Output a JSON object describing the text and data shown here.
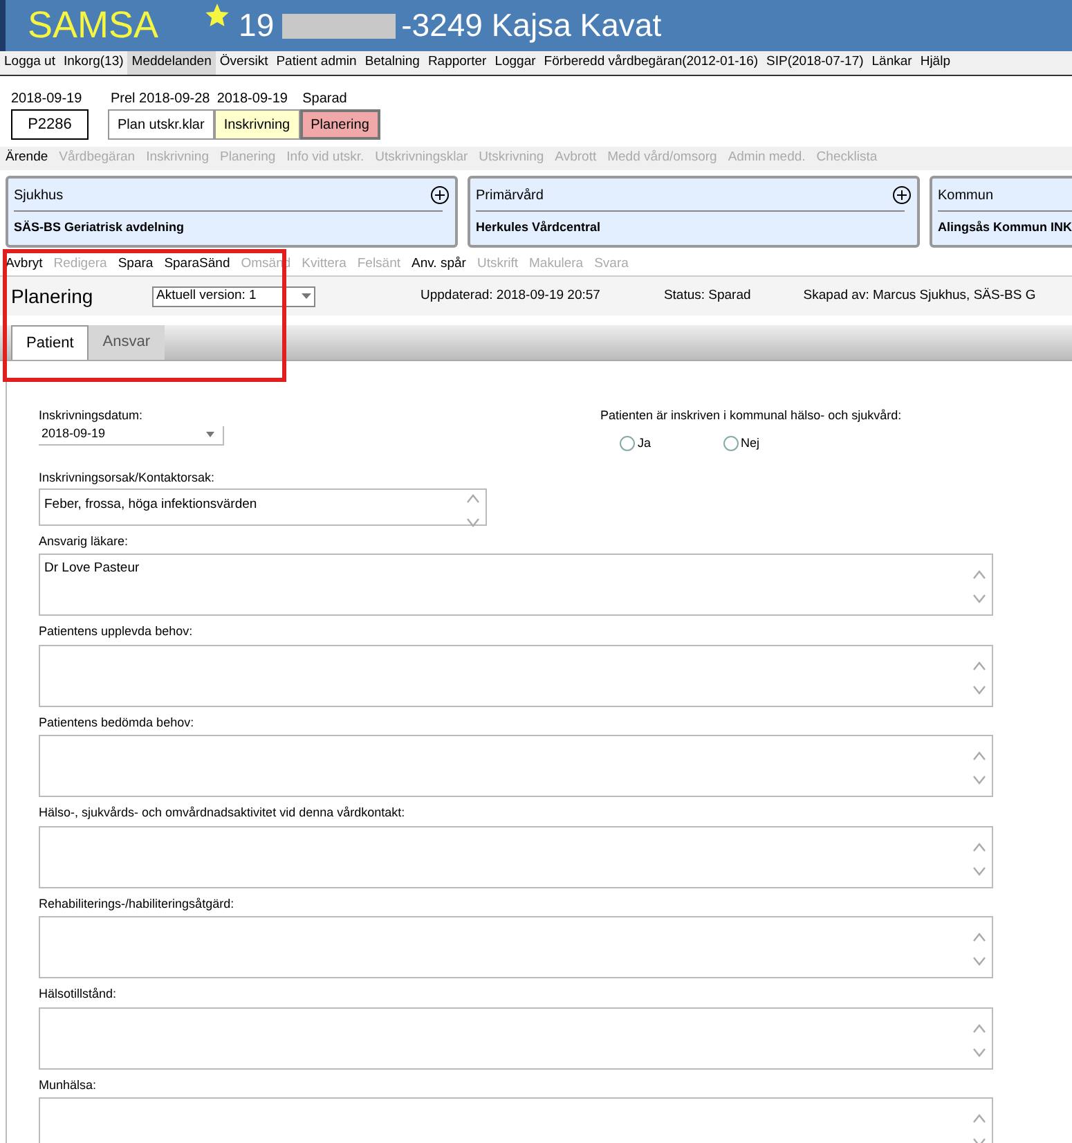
{
  "header": {
    "logo": "SAMSA",
    "patient_prefix": "19",
    "patient_suffix": "-3249 Kajsa Kavat"
  },
  "menu": [
    {
      "label": "Logga ut",
      "selected": false
    },
    {
      "label": "Inkorg(13)",
      "selected": false
    },
    {
      "label": "Meddelanden",
      "selected": true
    },
    {
      "label": "Översikt",
      "selected": false
    },
    {
      "label": "Patient admin",
      "selected": false
    },
    {
      "label": "Betalning",
      "selected": false
    },
    {
      "label": "Rapporter",
      "selected": false
    },
    {
      "label": "Loggar",
      "selected": false
    },
    {
      "label": "Förberedd vårdbegäran(2012-01-16)",
      "selected": false
    },
    {
      "label": "SIP(2018-07-17)",
      "selected": false
    },
    {
      "label": "Länkar",
      "selected": false
    },
    {
      "label": "Hjälp",
      "selected": false
    }
  ],
  "case": {
    "date": "2018-09-19",
    "id": "P2286"
  },
  "timeline": [
    {
      "date": "Prel 2018-09-28",
      "label": "Plan utskr.klar",
      "color": "#ffffff",
      "selected": false
    },
    {
      "date": "2018-09-19",
      "label": "Inskrivning",
      "color": "#ffffcc",
      "selected": false
    },
    {
      "date": "Sparad",
      "label": "Planering",
      "color": "#f0a8a8",
      "selected": true
    }
  ],
  "case_tabs": [
    {
      "label": "Ärende",
      "disabled": false
    },
    {
      "label": "Vårdbegäran",
      "disabled": true
    },
    {
      "label": "Inskrivning",
      "disabled": true
    },
    {
      "label": "Planering",
      "disabled": true
    },
    {
      "label": "Info vid utskr.",
      "disabled": true
    },
    {
      "label": "Utskrivningsklar",
      "disabled": true
    },
    {
      "label": "Utskrivning",
      "disabled": true
    },
    {
      "label": "Avbrott",
      "disabled": true
    },
    {
      "label": "Medd vård/omsorg",
      "disabled": true
    },
    {
      "label": "Admin medd.",
      "disabled": true
    },
    {
      "label": "Checklista",
      "disabled": true
    }
  ],
  "units": [
    {
      "type": "Sjukhus",
      "name": "SÄS-BS Geriatrisk avdelning",
      "addable": true
    },
    {
      "type": "Primärvård",
      "name": "Herkules Vårdcentral",
      "addable": true
    },
    {
      "type": "Kommun",
      "name": "Alingsås Kommun INK"
    }
  ],
  "actions": [
    {
      "label": "Avbryt",
      "disabled": false
    },
    {
      "label": "Redigera",
      "disabled": true
    },
    {
      "label": "Spara",
      "disabled": false
    },
    {
      "label": "SparaSänd",
      "disabled": false
    },
    {
      "label": "Omsänd",
      "disabled": true
    },
    {
      "label": "Kvittera",
      "disabled": true
    },
    {
      "label": "Felsänt",
      "disabled": true
    },
    {
      "label": "Anv. spår",
      "disabled": false
    },
    {
      "label": "Utskrift",
      "disabled": true
    },
    {
      "label": "Makulera",
      "disabled": true
    },
    {
      "label": "Svara",
      "disabled": true
    }
  ],
  "document": {
    "title": "Planering",
    "version": "Aktuell version: 1",
    "updated": "Uppdaterad: 2018-09-19 20:57",
    "status": "Status: Sparad",
    "created_by": "Skapad av: Marcus Sjukhus, SÄS-BS G"
  },
  "tabs": [
    {
      "label": "Patient",
      "selected": true
    },
    {
      "label": "Ansvar",
      "selected": false
    }
  ],
  "form": {
    "date_label": "Inskrivningsdatum:",
    "date_value": "2018-09-19",
    "enrolled_label": "Patienten är inskriven i kommunal hälso- och sjukvård:",
    "enrolled_options": [
      {
        "label": "Ja",
        "selected": false
      },
      {
        "label": "Nej",
        "selected": false
      }
    ],
    "reason_label": "Inskrivningsorsak/Kontaktorsak:",
    "reason_value": "Feber, frossa, höga infektionsvärden",
    "fields": [
      {
        "label": "Ansvarig läkare:",
        "value": "Dr Love Pasteur"
      },
      {
        "label": "Patientens upplevda behov:"
      },
      {
        "label": "Patientens bedömda behov:"
      },
      {
        "label": "Hälso-, sjukvårds- och omvårdnadsaktivitet vid denna vårdkontakt:"
      },
      {
        "label": "Rehabiliterings-/habiliteringsåtgärd:"
      },
      {
        "label": "Hälsotillstånd:"
      },
      {
        "label": "Munhälsa:"
      }
    ]
  }
}
